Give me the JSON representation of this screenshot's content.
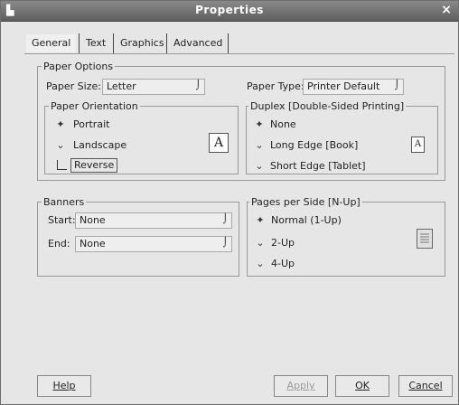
{
  "window": {
    "title": "Properties",
    "close_glyph": "×",
    "app_glyph": "▙"
  },
  "tabs": [
    {
      "label": "General",
      "active": true
    },
    {
      "label": "Text",
      "active": false
    },
    {
      "label": "Graphics",
      "active": false
    },
    {
      "label": "Advanced",
      "active": false
    }
  ],
  "paper_options": {
    "legend": "Paper Options",
    "size_label": "Paper Size:",
    "size_value": "Letter",
    "type_label": "Paper Type:",
    "type_value": "Printer Default"
  },
  "orientation": {
    "legend": "Paper Orientation",
    "options": [
      {
        "label": "Portrait",
        "selected": true
      },
      {
        "label": "Landscape",
        "selected": false
      }
    ],
    "reverse_label": "Reverse",
    "reverse_checked": false,
    "preview_glyph": "A"
  },
  "duplex": {
    "legend": "Duplex [Double-Sided Printing]",
    "options": [
      {
        "label": "None",
        "selected": true
      },
      {
        "label": "Long Edge [Book]",
        "selected": false
      },
      {
        "label": "Short Edge [Tablet]",
        "selected": false
      }
    ],
    "preview_glyph": "A"
  },
  "banners": {
    "legend": "Banners",
    "start_label": "Start:",
    "start_value": "None",
    "end_label": "End:",
    "end_value": "None"
  },
  "nup": {
    "legend": "Pages per Side [N-Up]",
    "options": [
      {
        "label": "Normal (1-Up)",
        "selected": true
      },
      {
        "label": "2-Up",
        "selected": false
      },
      {
        "label": "4-Up",
        "selected": false
      }
    ]
  },
  "buttons": {
    "help": "Help",
    "apply": "Apply",
    "ok": "OK",
    "cancel": "Cancel"
  },
  "glyphs": {
    "radio_on": "✦",
    "radio_off": "⌄",
    "combo_arrow": "⌡"
  }
}
